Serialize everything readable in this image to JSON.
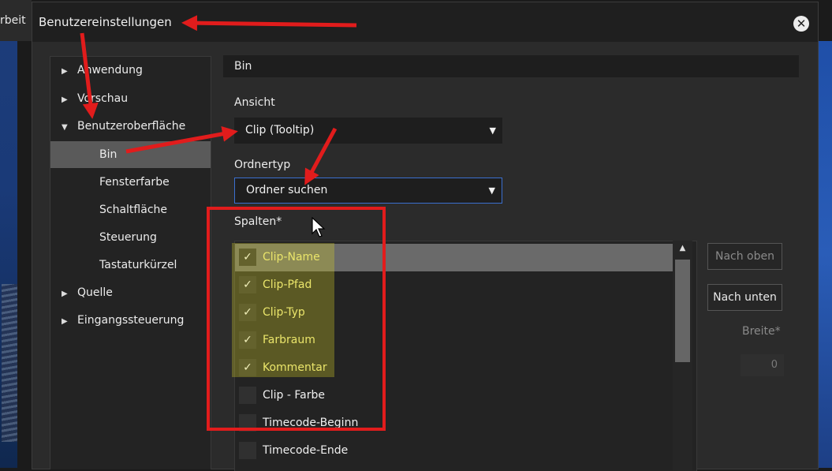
{
  "background_window": {
    "partial_label": "rbeit"
  },
  "dialog": {
    "title": "Benutzereinstellungen",
    "close_icon": "close-icon"
  },
  "nav": {
    "items": [
      {
        "label": "Anwendung",
        "arrow": "▶"
      },
      {
        "label": "Vorschau",
        "arrow": "▶"
      },
      {
        "label": "Benutzeroberfläche",
        "arrow": "▼"
      },
      {
        "label": "Bin",
        "selected": true
      },
      {
        "label": "Fensterfarbe"
      },
      {
        "label": "Schaltfläche"
      },
      {
        "label": "Steuerung"
      },
      {
        "label": "Tastaturkürzel"
      },
      {
        "label": "Quelle",
        "arrow": "▶"
      },
      {
        "label": "Eingangssteuerung",
        "arrow": "▶"
      }
    ]
  },
  "content": {
    "section_title": "Bin",
    "ansicht_label": "Ansicht",
    "ansicht_value": "Clip (Tooltip)",
    "ordnertyp_label": "Ordnertyp",
    "ordnertyp_value": "Ordner suchen",
    "spalten_label": "Spalten*",
    "columns": [
      {
        "label": "Clip-Name",
        "checked": true,
        "selected": true
      },
      {
        "label": "Clip-Pfad",
        "checked": true
      },
      {
        "label": "Clip-Typ",
        "checked": true
      },
      {
        "label": "Farbraum",
        "checked": true
      },
      {
        "label": "Kommentar",
        "checked": true
      },
      {
        "label": "Clip - Farbe",
        "checked": false
      },
      {
        "label": "Timecode-Beginn",
        "checked": false
      },
      {
        "label": "Timecode-Ende",
        "checked": false
      }
    ],
    "check_mark": "✓",
    "nach_oben": "Nach oben",
    "nach_unten": "Nach unten",
    "breite_label": "Breite*",
    "breite_value": "0"
  },
  "colors": {
    "annotation_red": "#e11c1c",
    "highlight_yellow": "#d4ce28",
    "focus_blue": "#3b6fcf"
  }
}
